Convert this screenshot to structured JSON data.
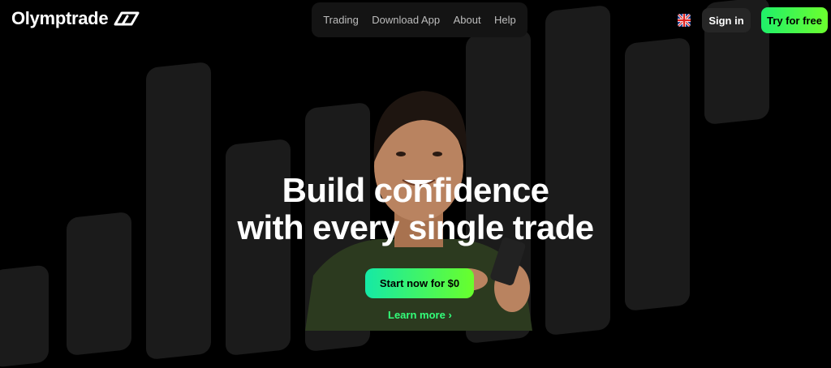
{
  "brand": {
    "name": "Olymptrade"
  },
  "nav": {
    "items": [
      "Trading",
      "Download App",
      "About",
      "Help"
    ]
  },
  "header": {
    "sign_in": "Sign in",
    "try_free": "Try for free",
    "language_icon": "uk-flag-icon"
  },
  "hero": {
    "headline_line1": "Build confidence",
    "headline_line2": "with every single trade",
    "cta": "Start now for $0",
    "learn_more": "Learn more",
    "learn_more_icon": "chevron-right-icon"
  },
  "colors": {
    "background": "#000000",
    "accent_start": "#15e9a6",
    "accent_end": "#69ff2b",
    "bar": "#1b1b1b"
  }
}
